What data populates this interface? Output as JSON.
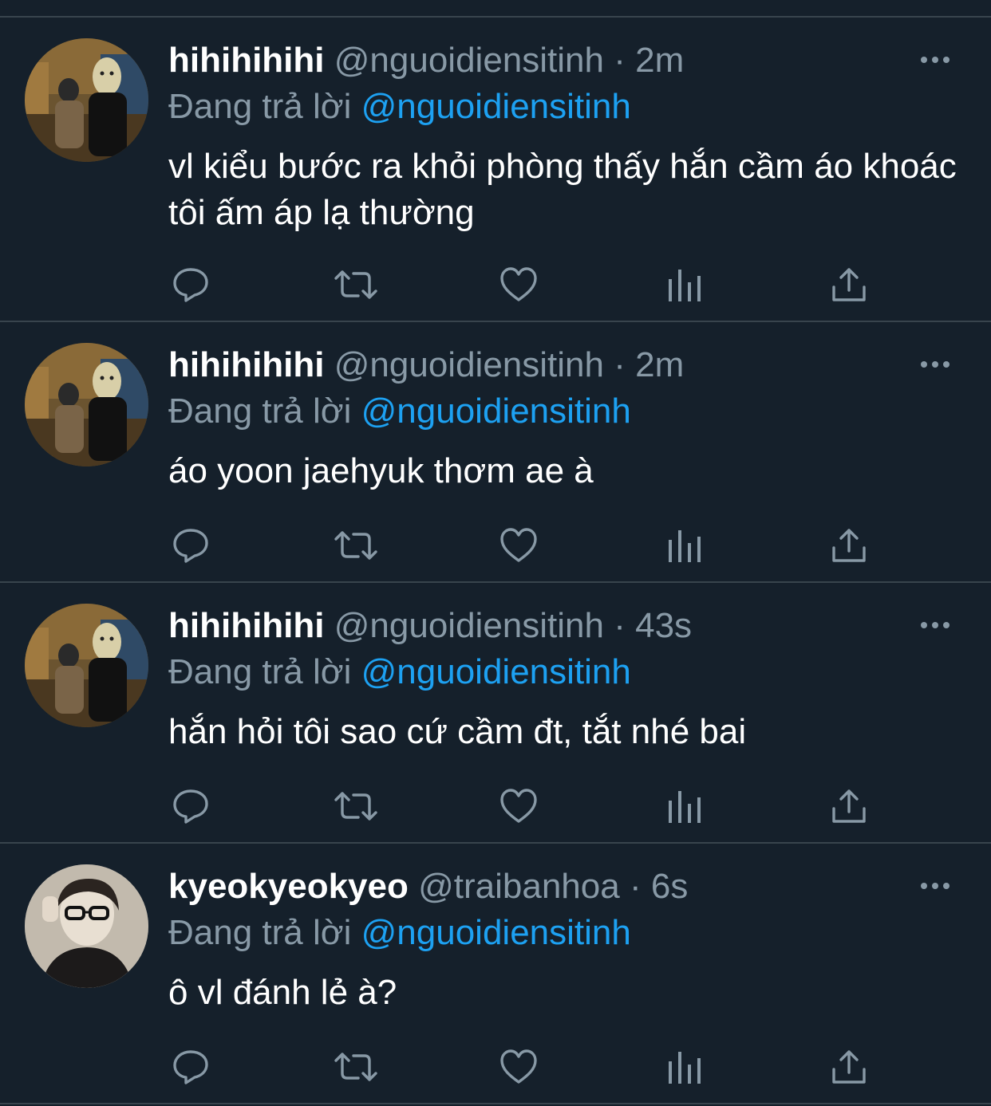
{
  "colors": {
    "background": "#15202b",
    "divider": "#38444d",
    "secondary_text": "#8899a6",
    "mention": "#1da1f2",
    "primary_text": "#ffffff"
  },
  "tweets": [
    {
      "display_name": "hihihihihi",
      "handle": "@nguoidiensitinh",
      "separator": "·",
      "time": "2m",
      "reply_prefix": "Đang trả lời",
      "reply_to": "@nguoidiensitinh",
      "text": "vl kiểu bước ra khỏi phòng thấy hắn cầm áo khoác tôi ấm áp lạ thường",
      "icons": [
        "reply-icon",
        "retweet-icon",
        "like-icon",
        "analytics-icon",
        "share-icon"
      ]
    },
    {
      "display_name": "hihihihihi",
      "handle": "@nguoidiensitinh",
      "separator": "·",
      "time": "2m",
      "reply_prefix": "Đang trả lời",
      "reply_to": "@nguoidiensitinh",
      "text": "áo yoon jaehyuk thơm ae à",
      "icons": [
        "reply-icon",
        "retweet-icon",
        "like-icon",
        "analytics-icon",
        "share-icon"
      ]
    },
    {
      "display_name": "hihihihihi",
      "handle": "@nguoidiensitinh",
      "separator": "·",
      "time": "43s",
      "reply_prefix": "Đang trả lời",
      "reply_to": "@nguoidiensitinh",
      "text": "hắn hỏi tôi sao cứ cầm đt, tắt nhé bai",
      "icons": [
        "reply-icon",
        "retweet-icon",
        "like-icon",
        "analytics-icon",
        "share-icon"
      ]
    },
    {
      "display_name": "kyeokyeokyeo",
      "handle": "@traibanhoa",
      "separator": "·",
      "time": "6s",
      "reply_prefix": "Đang trả lời",
      "reply_to": "@nguoidiensitinh",
      "text": "ô vl đánh lẻ à?",
      "icons": [
        "reply-icon",
        "retweet-icon",
        "like-icon",
        "analytics-icon",
        "share-icon"
      ]
    }
  ]
}
